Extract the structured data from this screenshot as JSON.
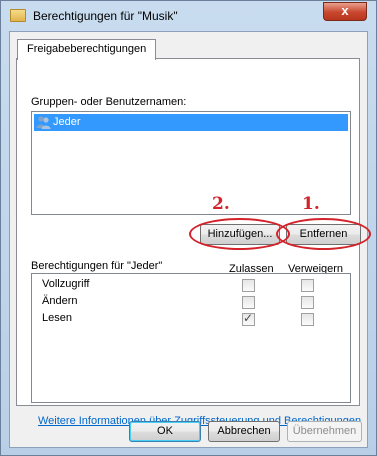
{
  "window": {
    "title": "Berechtigungen für \"Musik\"",
    "close_glyph": "x"
  },
  "tab": {
    "label": "Freigabeberechtigungen"
  },
  "groups": {
    "label": "Gruppen- oder Benutzernamen:",
    "items": [
      "Jeder"
    ]
  },
  "buttons": {
    "add": "Hinzufügen...",
    "remove": "Entfernen",
    "ok": "OK",
    "cancel": "Abbrechen",
    "apply": "Übernehmen"
  },
  "annotations": {
    "first": "1.",
    "second": "2."
  },
  "permissions": {
    "header": "Berechtigungen für \"Jeder\"",
    "allow_header": "Zulassen",
    "deny_header": "Verweigern",
    "rows": [
      {
        "name": "Vollzugriff",
        "allow": false,
        "deny": false
      },
      {
        "name": "Ändern",
        "allow": false,
        "deny": false
      },
      {
        "name": "Lesen",
        "allow": true,
        "deny": false
      }
    ]
  },
  "link": "Weitere Informationen über Zugriffssteuerung und Berechtigungen",
  "colors": {
    "annotation": "#d2232a",
    "selection": "#3399ff",
    "link": "#0066cc"
  },
  "icons": {
    "title": "folder-icon",
    "list_item": "users-icon",
    "check": "✓"
  }
}
